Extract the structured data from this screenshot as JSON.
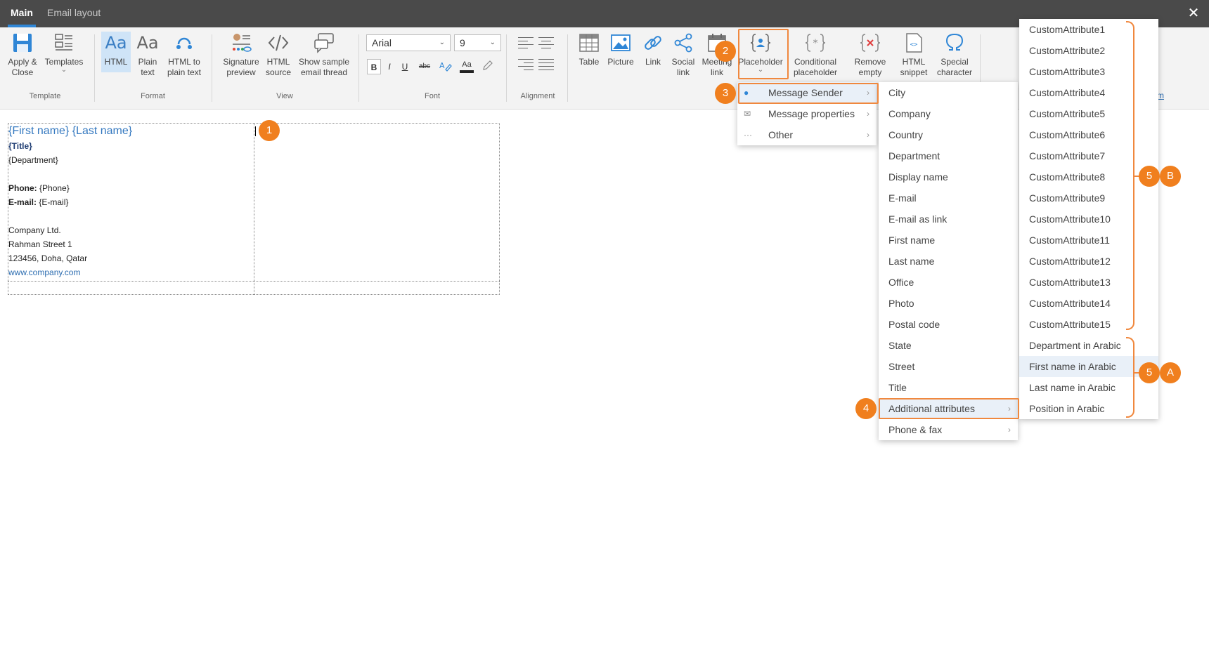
{
  "tabs": [
    {
      "label": "Main",
      "active": true
    },
    {
      "label": "Email layout",
      "active": false
    }
  ],
  "close_glyph": "✕",
  "ribbon": {
    "template_group": {
      "label": "Template",
      "apply_close": "Apply &\nClose",
      "templates": "Templates"
    },
    "format_group": {
      "label": "Format",
      "html": "HTML",
      "plain_text": "Plain\ntext",
      "html_to_plain": "HTML to\nplain text",
      "aa_glyph": "Aa"
    },
    "view_group": {
      "label": "View",
      "signature_preview": "Signature\npreview",
      "html_source": "HTML\nsource",
      "show_sample": "Show sample\nemail thread"
    },
    "font_group": {
      "label": "Font",
      "font_name": "Arial",
      "font_size": "9",
      "bold": "B",
      "italic": "I",
      "underline": "U",
      "strike": "abc",
      "font_color_glyph": "Aa"
    },
    "alignment_group": {
      "label": "Alignment"
    },
    "insert_group": {
      "table": "Table",
      "picture": "Picture",
      "link": "Link",
      "social_link": "Social\nlink",
      "meeting_link": "Meeting\nlink",
      "placeholder": "Placeholder",
      "conditional_placeholder": "Conditional\nplaceholder",
      "remove_empty": "Remove\nempty",
      "html_snippet": "HTML\nsnippet",
      "special_character": "Special\ncharacter"
    },
    "problem_link": "blem"
  },
  "signature": {
    "name": "{First name} {Last name}",
    "title": "{Title}",
    "department": "{Department}",
    "phone_label": "Phone:",
    "phone_value": " {Phone}",
    "email_label": "E-mail:",
    "email_value": " {E-mail}",
    "company": "Company Ltd.",
    "street": "Rahman Street 1",
    "city": "123456, Doha, Qatar",
    "website": "www.company.com"
  },
  "menu_level1": [
    {
      "label": "Message Sender",
      "icon": "person-icon",
      "highlighted": true
    },
    {
      "label": "Message properties",
      "icon": "envelope-icon",
      "highlighted": false
    },
    {
      "label": "Other",
      "icon": "more-dots-icon",
      "highlighted": false
    }
  ],
  "menu_level2": [
    "City",
    "Company",
    "Country",
    "Department",
    "Display name",
    "E-mail",
    "E-mail as link",
    "First name",
    "Last name",
    "Office",
    "Photo",
    "Postal code",
    "State",
    "Street",
    "Title",
    "Additional attributes",
    "Phone & fax"
  ],
  "menu_level3": [
    "CustomAttribute1",
    "CustomAttribute2",
    "CustomAttribute3",
    "CustomAttribute4",
    "CustomAttribute5",
    "CustomAttribute6",
    "CustomAttribute7",
    "CustomAttribute8",
    "CustomAttribute9",
    "CustomAttribute10",
    "CustomAttribute11",
    "CustomAttribute12",
    "CustomAttribute13",
    "CustomAttribute14",
    "CustomAttribute15",
    "Department in Arabic",
    "First name in Arabic",
    "Last name in Arabic",
    "Position in Arabic"
  ],
  "annotations": {
    "b1": "1",
    "b2": "2",
    "b3": "3",
    "b4": "4",
    "b5a": "5",
    "a": "A",
    "b5b": "5",
    "b": "B",
    "color": "#f07f1e"
  },
  "arrow_glyph": "›",
  "chevron_glyph": "⌄"
}
